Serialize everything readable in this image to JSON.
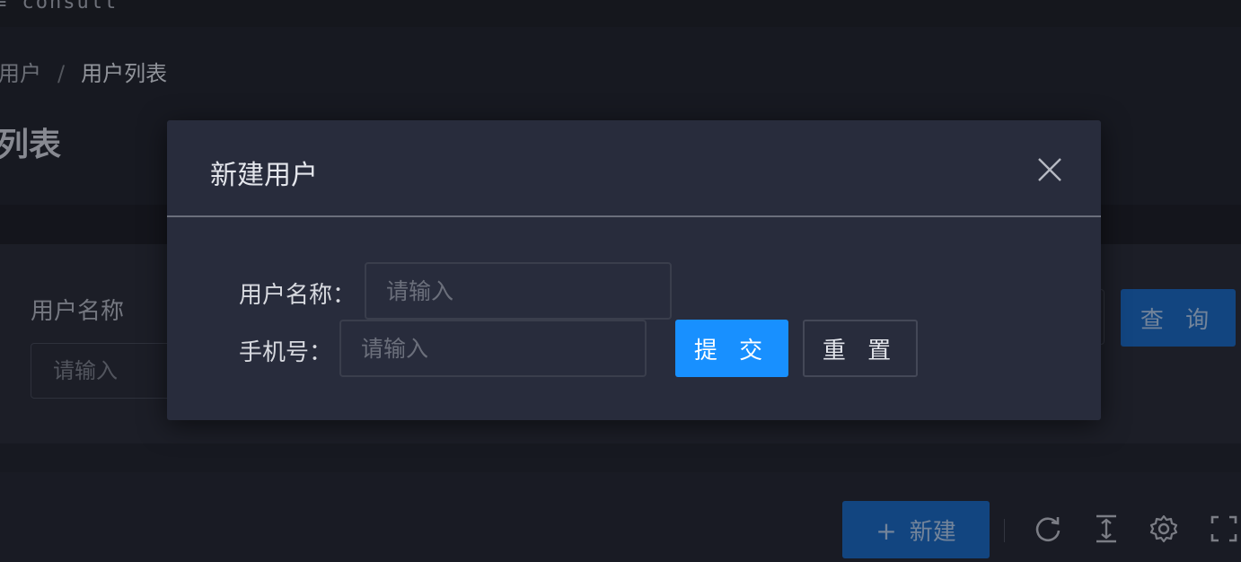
{
  "app": {
    "logo_text": "consult"
  },
  "breadcrumb": {
    "parent": "用户",
    "separator": "/",
    "current": "用户列表"
  },
  "page": {
    "title": "列表"
  },
  "filter": {
    "name_label": "用户名称",
    "name_placeholder": "请输入",
    "query_label": "查 询"
  },
  "toolbar": {
    "new_label": "新建",
    "icons": [
      "refresh-icon",
      "column-height-icon",
      "setting-icon",
      "fullscreen-icon"
    ]
  },
  "modal": {
    "title": "新建用户",
    "fields": [
      {
        "label": "用户名称：",
        "placeholder": "请输入",
        "value": ""
      },
      {
        "label": "手机号：",
        "placeholder": "请输入",
        "value": ""
      }
    ],
    "submit_label": "提 交",
    "reset_label": "重 置"
  },
  "colors": {
    "primary": "#1890ff",
    "primary_dim": "#154f92",
    "modal_bg": "#282c3c",
    "page_bg": "#1b1d26"
  }
}
